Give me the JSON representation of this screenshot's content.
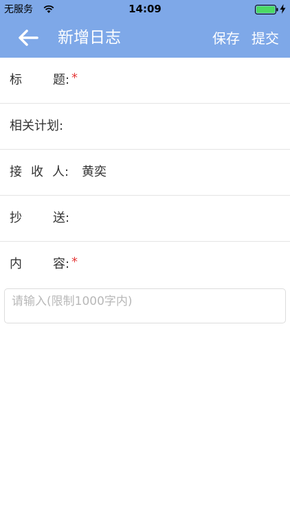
{
  "status_bar": {
    "carrier": "无服务",
    "time": "14:09",
    "icons": [
      "wifi-icon",
      "battery-icon",
      "charging-icon"
    ]
  },
  "nav": {
    "back_icon": "back-arrow-icon",
    "title": "新增日志",
    "save_label": "保存",
    "submit_label": "提交"
  },
  "form": {
    "title_label": {
      "first": "标",
      "second": "题:",
      "required_mark": "*"
    },
    "related_plan_label": "相关计划:",
    "receiver_label": {
      "first": "接",
      "second": "收",
      "third": "人:"
    },
    "receiver_value": "黄奕",
    "cc_label": {
      "first": "抄",
      "second": "送:"
    },
    "content_label": {
      "first": "内",
      "second": "容:",
      "required_mark": "*"
    },
    "content_placeholder": "请输入(限制1000字内)"
  },
  "colors": {
    "header_bg": "#7ea8e8",
    "header_text": "#ffffff",
    "required": "#e53a3a",
    "placeholder": "#b8b8b8",
    "divider": "#e4e4e4"
  }
}
